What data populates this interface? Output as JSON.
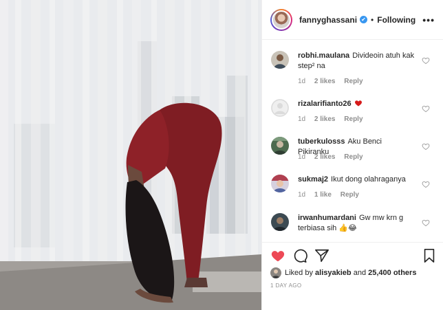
{
  "post": {
    "owner": "fannyghassani",
    "verified": "✔",
    "separator": "•",
    "follow_state": "Following",
    "more_label": "•••"
  },
  "comments": [
    {
      "user": "robhi.maulana",
      "text": "Divideoin atuh kak step² na",
      "age": "1d",
      "likes": "2 likes",
      "reply": "Reply"
    },
    {
      "user": "rizalarifianto26",
      "text": "",
      "age": "1d",
      "likes": "2 likes",
      "reply": "Reply"
    },
    {
      "user": "tuberkulosss",
      "text": "Aku Benci Pikiranku",
      "age": "1d",
      "likes": "2 likes",
      "reply": "Reply"
    },
    {
      "user": "sukmaj2",
      "text": "Ikut dong olahraganya",
      "age": "1d",
      "likes": "1 like",
      "reply": "Reply"
    },
    {
      "user": "irwanhumardani",
      "text": "Gw mw krn g terbiasa sih 👍😂",
      "age": "",
      "likes": "",
      "reply": ""
    }
  ],
  "likes": {
    "prefix": "Liked by",
    "user": "alisyakieb",
    "middle": "and",
    "others": "25,400 others"
  },
  "timestamp": "1 DAY AGO",
  "colors": {
    "liked_heart": "#ed4956",
    "verified": "#3897f0",
    "secondary_text": "#8e8e8e"
  }
}
